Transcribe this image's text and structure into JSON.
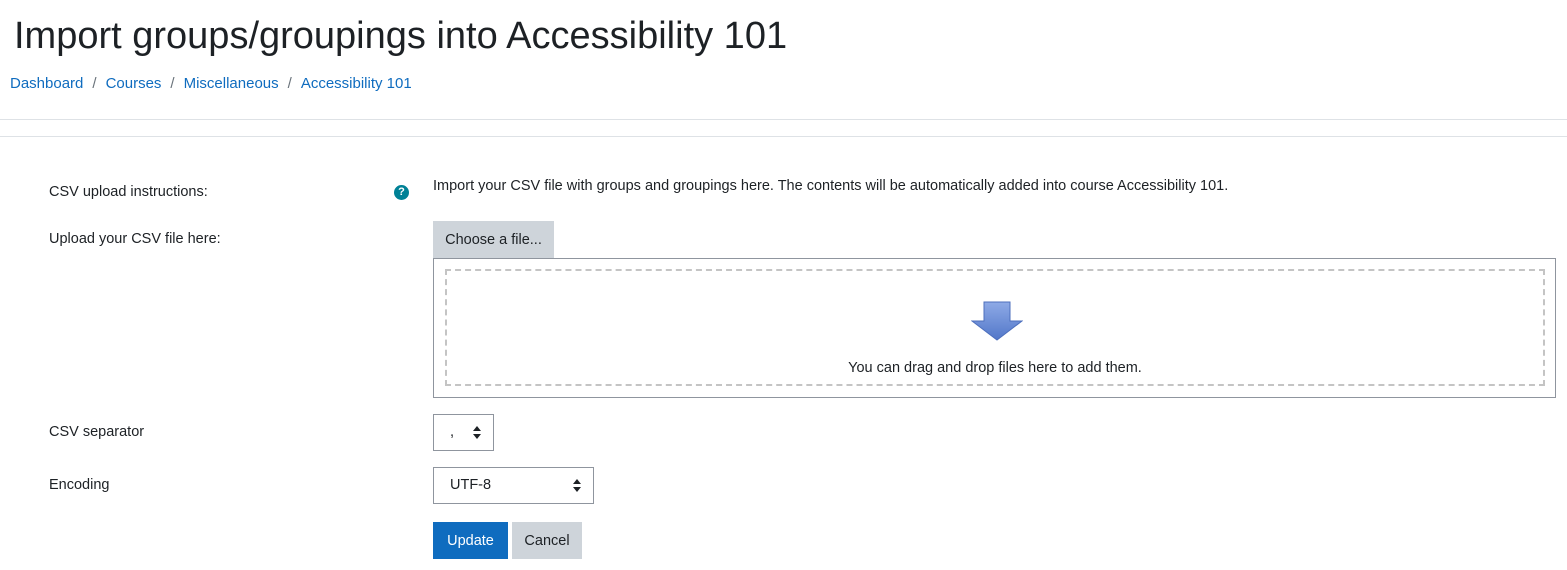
{
  "header": {
    "title": "Import groups/groupings into Accessibility 101",
    "breadcrumb": [
      {
        "label": "Dashboard"
      },
      {
        "label": "Courses"
      },
      {
        "label": "Miscellaneous"
      },
      {
        "label": "Accessibility 101"
      }
    ],
    "separator": "/"
  },
  "form": {
    "instructions_label": "CSV upload instructions:",
    "instructions_text": "Import your CSV file with groups and groupings here. The contents will be automatically added into course Accessibility 101.",
    "help_icon": "question-circle-icon",
    "upload_label": "Upload your CSV file here:",
    "choose_file_label": "Choose a file...",
    "drop_text": "You can drag and drop files here to add them.",
    "drop_icon": "down-arrow-icon",
    "separator_label": "CSV separator",
    "separator_value": ",",
    "encoding_label": "Encoding",
    "encoding_value": "UTF-8",
    "help_glyph": "?"
  },
  "actions": {
    "update_label": "Update",
    "cancel_label": "Cancel"
  },
  "colors": {
    "link": "#0f6cbf",
    "primary_button": "#0f6cbf",
    "secondary_button": "#ced4da",
    "help_icon": "#008196",
    "drop_arrow": "#6b8fd6"
  }
}
